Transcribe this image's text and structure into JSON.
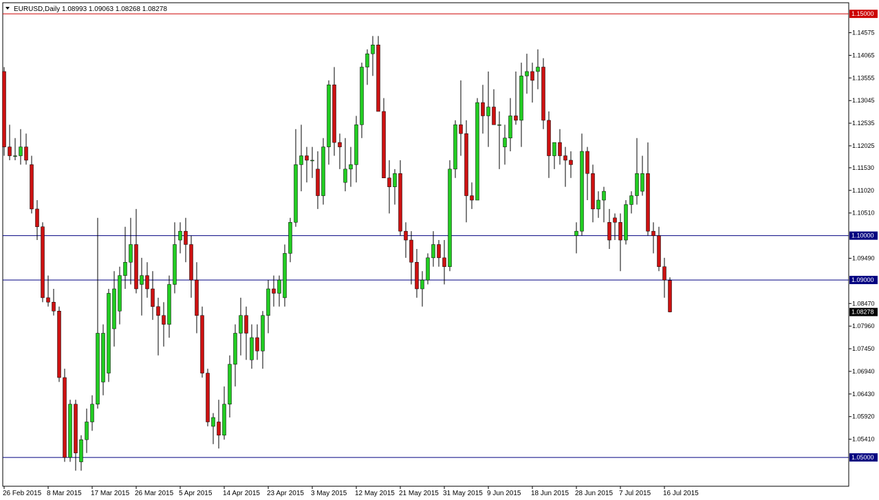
{
  "header": {
    "symbol_text": "EURUSD,Daily",
    "ohlc_text": "1.08993 1.09063 1.08268 1.08278"
  },
  "colors": {
    "bull": "#22cc22",
    "bear": "#cc1111",
    "hline": "#000080",
    "resistance": "#cc0000",
    "background": "#ffffff"
  },
  "chart_data": {
    "type": "candlestick",
    "symbol": "EURUSD",
    "timeframe": "Daily",
    "ylim": [
      1.0435,
      1.1525
    ],
    "y_ticks": [
      "1.14575",
      "1.14065",
      "1.13555",
      "1.13045",
      "1.12535",
      "1.12025",
      "1.11530",
      "1.11020",
      "1.10510",
      "1.09490",
      "1.08470",
      "1.07960",
      "1.07450",
      "1.06940",
      "1.06430",
      "1.05920",
      "1.05410"
    ],
    "x_labels": [
      "26 Feb 2015",
      "8 Mar 2015",
      "17 Mar 2015",
      "26 Mar 2015",
      "5 Apr 2015",
      "14 Apr 2015",
      "23 Apr 2015",
      "3 May 2015",
      "12 May 2015",
      "21 May 2015",
      "31 May 2015",
      "9 Jun 2015",
      "18 Jun 2015",
      "28 Jun 2015",
      "7 Jul 2015",
      "16 Jul 2015"
    ],
    "horizontal_lines": [
      {
        "price": 1.15,
        "label": "1.15000",
        "color": "#cc0000"
      },
      {
        "price": 1.1,
        "label": "1.10000",
        "color": "#000080"
      },
      {
        "price": 1.09,
        "label": "1.09000",
        "color": "#000080"
      },
      {
        "price": 1.05,
        "label": "1.05000",
        "color": "#000080"
      }
    ],
    "current_price": "1.08278",
    "candles": [
      [
        1.137,
        1.138,
        1.118,
        1.12
      ],
      [
        1.12,
        1.125,
        1.117,
        1.118
      ],
      [
        1.118,
        1.122,
        1.117,
        1.118
      ],
      [
        1.118,
        1.124,
        1.116,
        1.12
      ],
      [
        1.12,
        1.123,
        1.116,
        1.117
      ],
      [
        1.116,
        1.118,
        1.105,
        1.106
      ],
      [
        1.106,
        1.108,
        1.099,
        1.102
      ],
      [
        1.102,
        1.103,
        1.085,
        1.086
      ],
      [
        1.086,
        1.091,
        1.084,
        1.085
      ],
      [
        1.085,
        1.088,
        1.082,
        1.083
      ],
      [
        1.083,
        1.084,
        1.067,
        1.068
      ],
      [
        1.068,
        1.07,
        1.049,
        1.05
      ],
      [
        1.05,
        1.063,
        1.049,
        1.062
      ],
      [
        1.062,
        1.063,
        1.047,
        1.051
      ],
      [
        1.049,
        1.055,
        1.047,
        1.054
      ],
      [
        1.054,
        1.061,
        1.051,
        1.058
      ],
      [
        1.058,
        1.064,
        1.056,
        1.062
      ],
      [
        1.062,
        1.104,
        1.061,
        1.078
      ],
      [
        1.067,
        1.08,
        1.064,
        1.078
      ],
      [
        1.069,
        1.088,
        1.067,
        1.087
      ],
      [
        1.079,
        1.092,
        1.075,
        1.088
      ],
      [
        1.083,
        1.093,
        1.08,
        1.091
      ],
      [
        1.091,
        1.102,
        1.088,
        1.094
      ],
      [
        1.094,
        1.104,
        1.089,
        1.098
      ],
      [
        1.098,
        1.106,
        1.087,
        1.088
      ],
      [
        1.089,
        1.095,
        1.082,
        1.091
      ],
      [
        1.091,
        1.094,
        1.086,
        1.088
      ],
      [
        1.088,
        1.092,
        1.081,
        1.084
      ],
      [
        1.084,
        1.086,
        1.073,
        1.082
      ],
      [
        1.082,
        1.085,
        1.075,
        1.08
      ],
      [
        1.08,
        1.091,
        1.077,
        1.089
      ],
      [
        1.089,
        1.103,
        1.087,
        1.098
      ],
      [
        1.099,
        1.103,
        1.096,
        1.101
      ],
      [
        1.101,
        1.104,
        1.094,
        1.098
      ],
      [
        1.098,
        1.1,
        1.086,
        1.09
      ],
      [
        1.09,
        1.094,
        1.078,
        1.082
      ],
      [
        1.082,
        1.084,
        1.068,
        1.069
      ],
      [
        1.069,
        1.07,
        1.057,
        1.058
      ],
      [
        1.057,
        1.06,
        1.053,
        1.059
      ],
      [
        1.058,
        1.063,
        1.052,
        1.055
      ],
      [
        1.055,
        1.066,
        1.054,
        1.062
      ],
      [
        1.062,
        1.073,
        1.059,
        1.071
      ],
      [
        1.071,
        1.08,
        1.066,
        1.078
      ],
      [
        1.078,
        1.086,
        1.073,
        1.082
      ],
      [
        1.082,
        1.084,
        1.072,
        1.078
      ],
      [
        1.072,
        1.08,
        1.07,
        1.077
      ],
      [
        1.077,
        1.08,
        1.072,
        1.074
      ],
      [
        1.074,
        1.083,
        1.07,
        1.082
      ],
      [
        1.082,
        1.09,
        1.078,
        1.088
      ],
      [
        1.088,
        1.091,
        1.084,
        1.087
      ],
      [
        1.087,
        1.091,
        1.084,
        1.09
      ],
      [
        1.086,
        1.098,
        1.084,
        1.096
      ],
      [
        1.096,
        1.104,
        1.094,
        1.103
      ],
      [
        1.103,
        1.124,
        1.102,
        1.116
      ],
      [
        1.116,
        1.125,
        1.11,
        1.118
      ],
      [
        1.118,
        1.12,
        1.112,
        1.117
      ],
      [
        1.117,
        1.12,
        1.113,
        1.117
      ],
      [
        1.115,
        1.119,
        1.106,
        1.109
      ],
      [
        1.109,
        1.122,
        1.107,
        1.12
      ],
      [
        1.12,
        1.135,
        1.116,
        1.134
      ],
      [
        1.134,
        1.138,
        1.118,
        1.121
      ],
      [
        1.121,
        1.123,
        1.115,
        1.12
      ],
      [
        1.112,
        1.122,
        1.11,
        1.115
      ],
      [
        1.115,
        1.12,
        1.111,
        1.116
      ],
      [
        1.116,
        1.127,
        1.112,
        1.125
      ],
      [
        1.125,
        1.139,
        1.122,
        1.138
      ],
      [
        1.138,
        1.142,
        1.134,
        1.141
      ],
      [
        1.141,
        1.145,
        1.136,
        1.143
      ],
      [
        1.143,
        1.145,
        1.128,
        1.128
      ],
      [
        1.128,
        1.131,
        1.113,
        1.113
      ],
      [
        1.113,
        1.117,
        1.105,
        1.111
      ],
      [
        1.111,
        1.115,
        1.107,
        1.114
      ],
      [
        1.114,
        1.117,
        1.1,
        1.101
      ],
      [
        1.101,
        1.103,
        1.095,
        1.099
      ],
      [
        1.099,
        1.101,
        1.089,
        1.094
      ],
      [
        1.094,
        1.097,
        1.086,
        1.088
      ],
      [
        1.088,
        1.092,
        1.084,
        1.09
      ],
      [
        1.09,
        1.096,
        1.089,
        1.095
      ],
      [
        1.095,
        1.101,
        1.093,
        1.098
      ],
      [
        1.098,
        1.099,
        1.093,
        1.095
      ],
      [
        1.095,
        1.099,
        1.089,
        1.093
      ],
      [
        1.093,
        1.117,
        1.092,
        1.115
      ],
      [
        1.115,
        1.126,
        1.113,
        1.125
      ],
      [
        1.125,
        1.135,
        1.118,
        1.123
      ],
      [
        1.123,
        1.126,
        1.103,
        1.109
      ],
      [
        1.109,
        1.112,
        1.106,
        1.108
      ],
      [
        1.108,
        1.131,
        1.108,
        1.13
      ],
      [
        1.13,
        1.134,
        1.123,
        1.127
      ],
      [
        1.127,
        1.137,
        1.12,
        1.129
      ],
      [
        1.129,
        1.133,
        1.125,
        1.125
      ],
      [
        1.125,
        1.128,
        1.115,
        1.125
      ],
      [
        1.12,
        1.125,
        1.116,
        1.122
      ],
      [
        1.122,
        1.131,
        1.119,
        1.127
      ],
      [
        1.127,
        1.137,
        1.125,
        1.126
      ],
      [
        1.126,
        1.139,
        1.12,
        1.136
      ],
      [
        1.136,
        1.141,
        1.132,
        1.137
      ],
      [
        1.137,
        1.139,
        1.13,
        1.135
      ],
      [
        1.137,
        1.142,
        1.133,
        1.138
      ],
      [
        1.138,
        1.14,
        1.124,
        1.126
      ],
      [
        1.126,
        1.128,
        1.113,
        1.118
      ],
      [
        1.118,
        1.121,
        1.115,
        1.121
      ],
      [
        1.121,
        1.124,
        1.116,
        1.118
      ],
      [
        1.118,
        1.12,
        1.111,
        1.117
      ],
      [
        1.117,
        1.119,
        1.113,
        1.116
      ],
      [
        1.1,
        1.103,
        1.096,
        1.101
      ],
      [
        1.101,
        1.123,
        1.1,
        1.119
      ],
      [
        1.119,
        1.12,
        1.108,
        1.114
      ],
      [
        1.114,
        1.116,
        1.103,
        1.106
      ],
      [
        1.106,
        1.11,
        1.104,
        1.108
      ],
      [
        1.108,
        1.111,
        1.103,
        1.11
      ],
      [
        1.103,
        1.106,
        1.097,
        1.099
      ],
      [
        1.104,
        1.105,
        1.099,
        1.103
      ],
      [
        1.103,
        1.105,
        1.092,
        1.099
      ],
      [
        1.099,
        1.108,
        1.098,
        1.107
      ],
      [
        1.107,
        1.11,
        1.105,
        1.109
      ],
      [
        1.109,
        1.122,
        1.107,
        1.114
      ],
      [
        1.11,
        1.118,
        1.109,
        1.114
      ],
      [
        1.114,
        1.121,
        1.1,
        1.101
      ],
      [
        1.101,
        1.103,
        1.096,
        1.1
      ],
      [
        1.1,
        1.102,
        1.092,
        1.093
      ],
      [
        1.093,
        1.095,
        1.086,
        1.09
      ],
      [
        1.0899,
        1.0906,
        1.0827,
        1.0828
      ]
    ]
  }
}
